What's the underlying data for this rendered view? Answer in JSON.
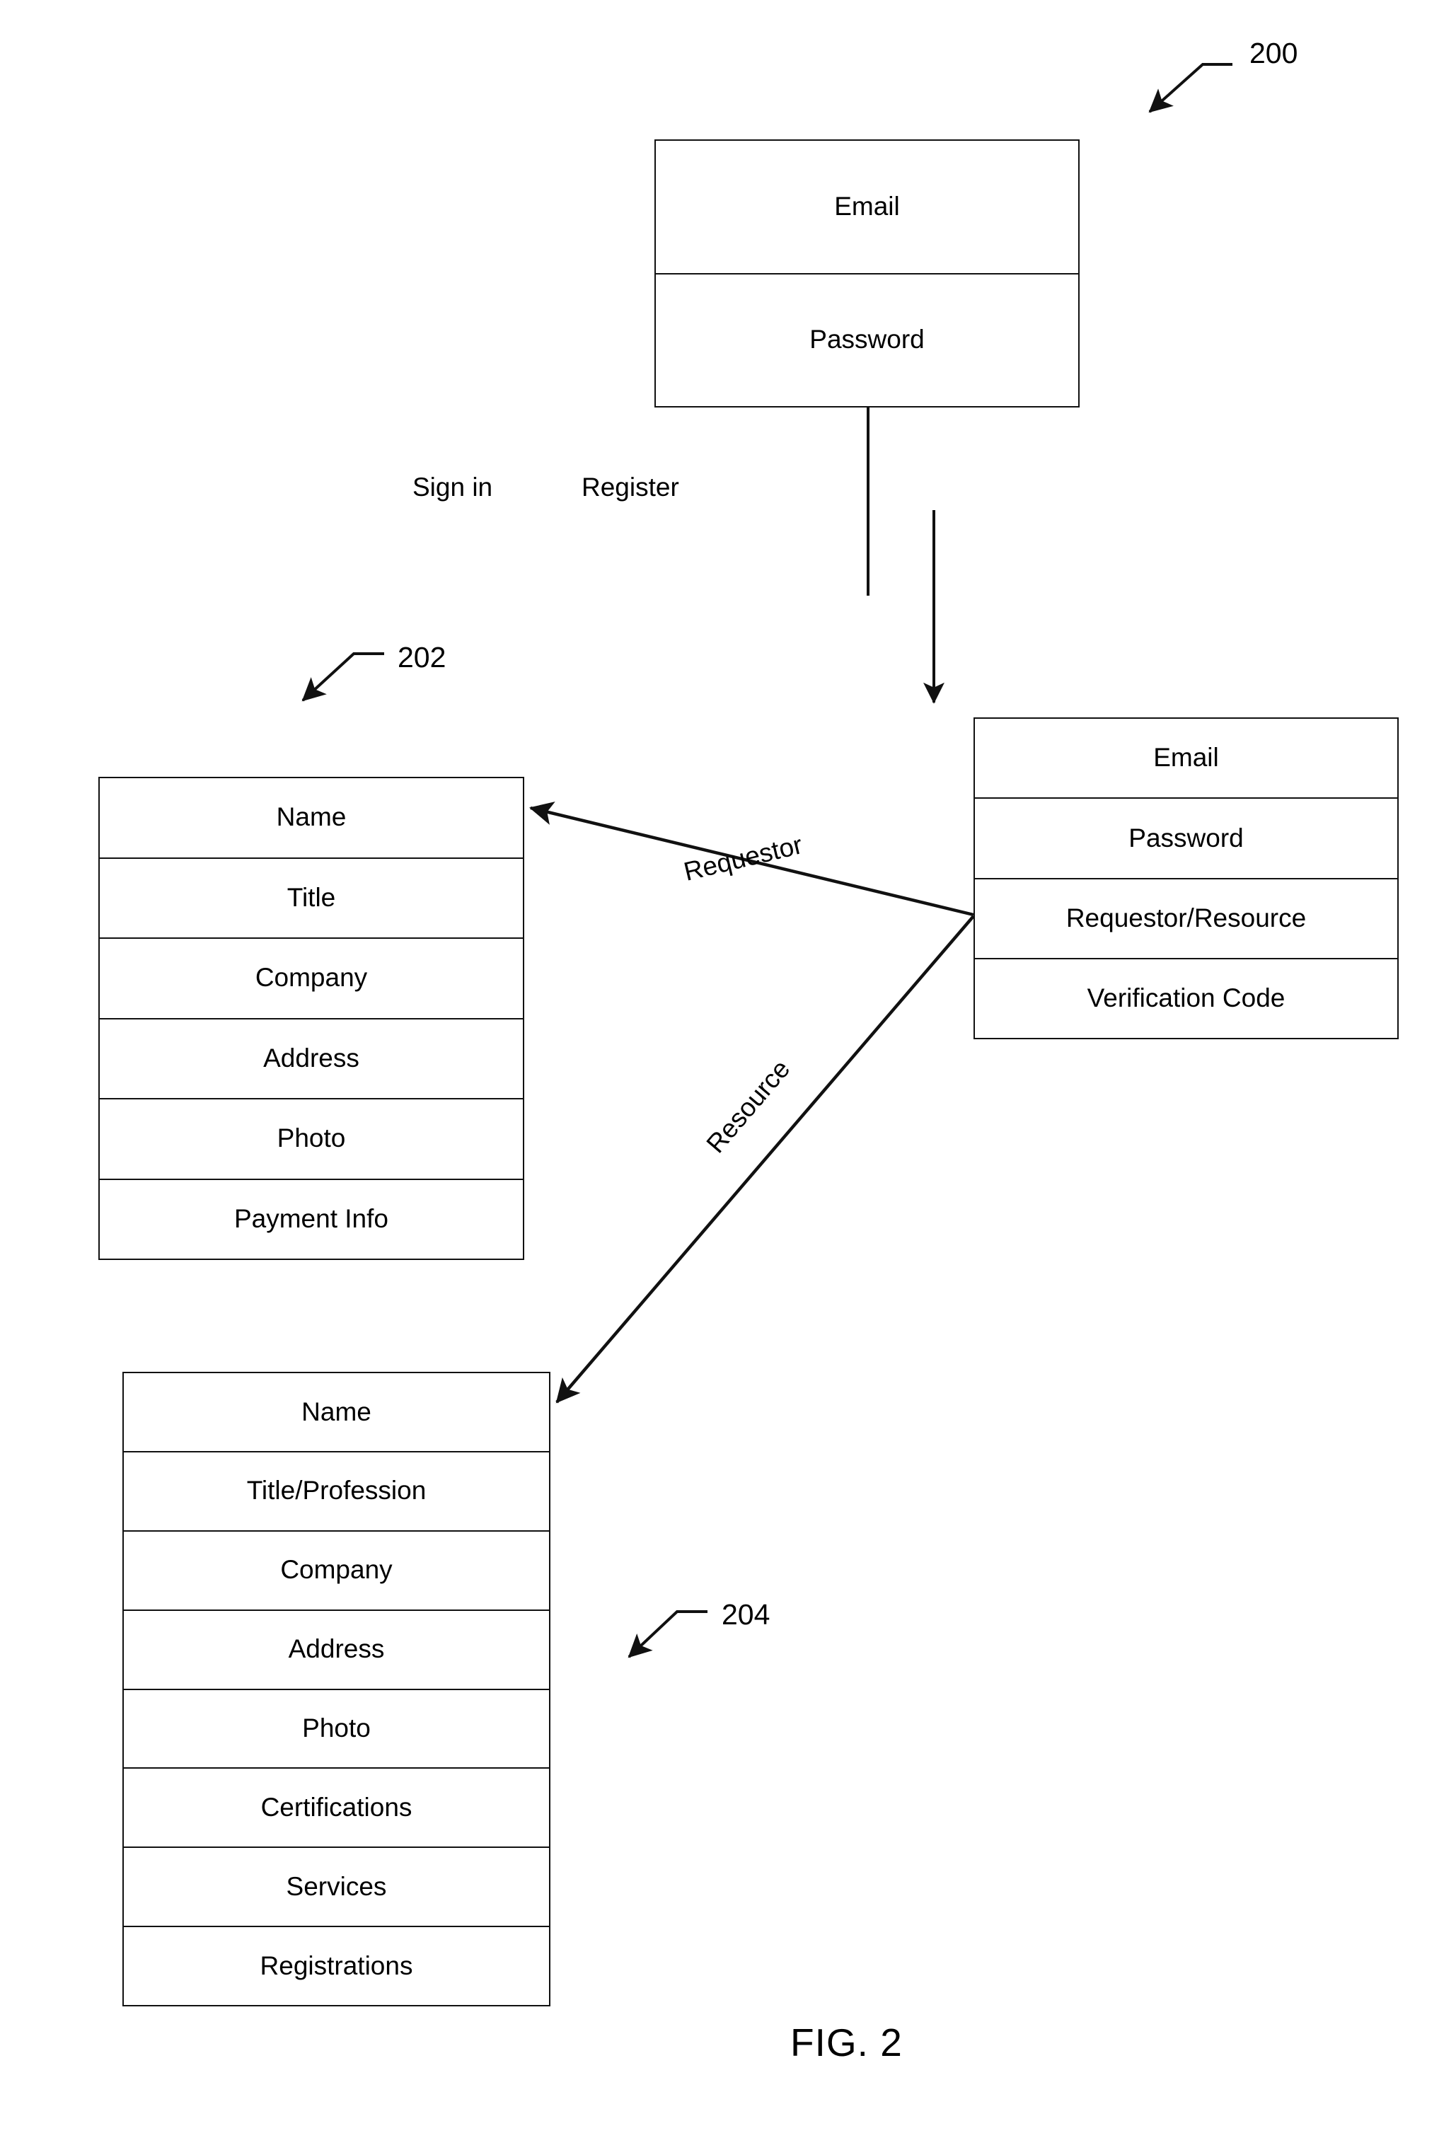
{
  "figure": {
    "caption": "FIG. 2",
    "reference_numerals": [
      {
        "id": "200",
        "label": "200"
      },
      {
        "id": "202",
        "label": "202"
      },
      {
        "id": "204",
        "label": "204"
      }
    ]
  },
  "boxes": {
    "auth": {
      "name": "sign-in-credentials",
      "rows": [
        {
          "label": "Email"
        },
        {
          "label": "Password"
        }
      ]
    },
    "register": {
      "name": "registration-record",
      "rows": [
        {
          "label": "Email"
        },
        {
          "label": "Password"
        },
        {
          "label": "Requestor/Resource"
        },
        {
          "label": "Verification Code"
        }
      ]
    },
    "requestor": {
      "name": "requestor-profile",
      "rows": [
        {
          "label": "Name"
        },
        {
          "label": "Title"
        },
        {
          "label": "Company"
        },
        {
          "label": "Address"
        },
        {
          "label": "Photo"
        },
        {
          "label": "Payment Info"
        }
      ]
    },
    "resource": {
      "name": "resource-profile",
      "rows": [
        {
          "label": "Name"
        },
        {
          "label": "Title/Profession"
        },
        {
          "label": "Company"
        },
        {
          "label": "Address"
        },
        {
          "label": "Photo"
        },
        {
          "label": "Certifications"
        },
        {
          "label": "Services"
        },
        {
          "label": "Registrations"
        }
      ]
    }
  },
  "edges": {
    "sign_in": {
      "label": "Sign in"
    },
    "register": {
      "label": "Register"
    },
    "requestor": {
      "label": "Requestor"
    },
    "resource": {
      "label": "Resource"
    }
  },
  "style": {
    "line_color": "#111111",
    "background": "#ffffff"
  }
}
